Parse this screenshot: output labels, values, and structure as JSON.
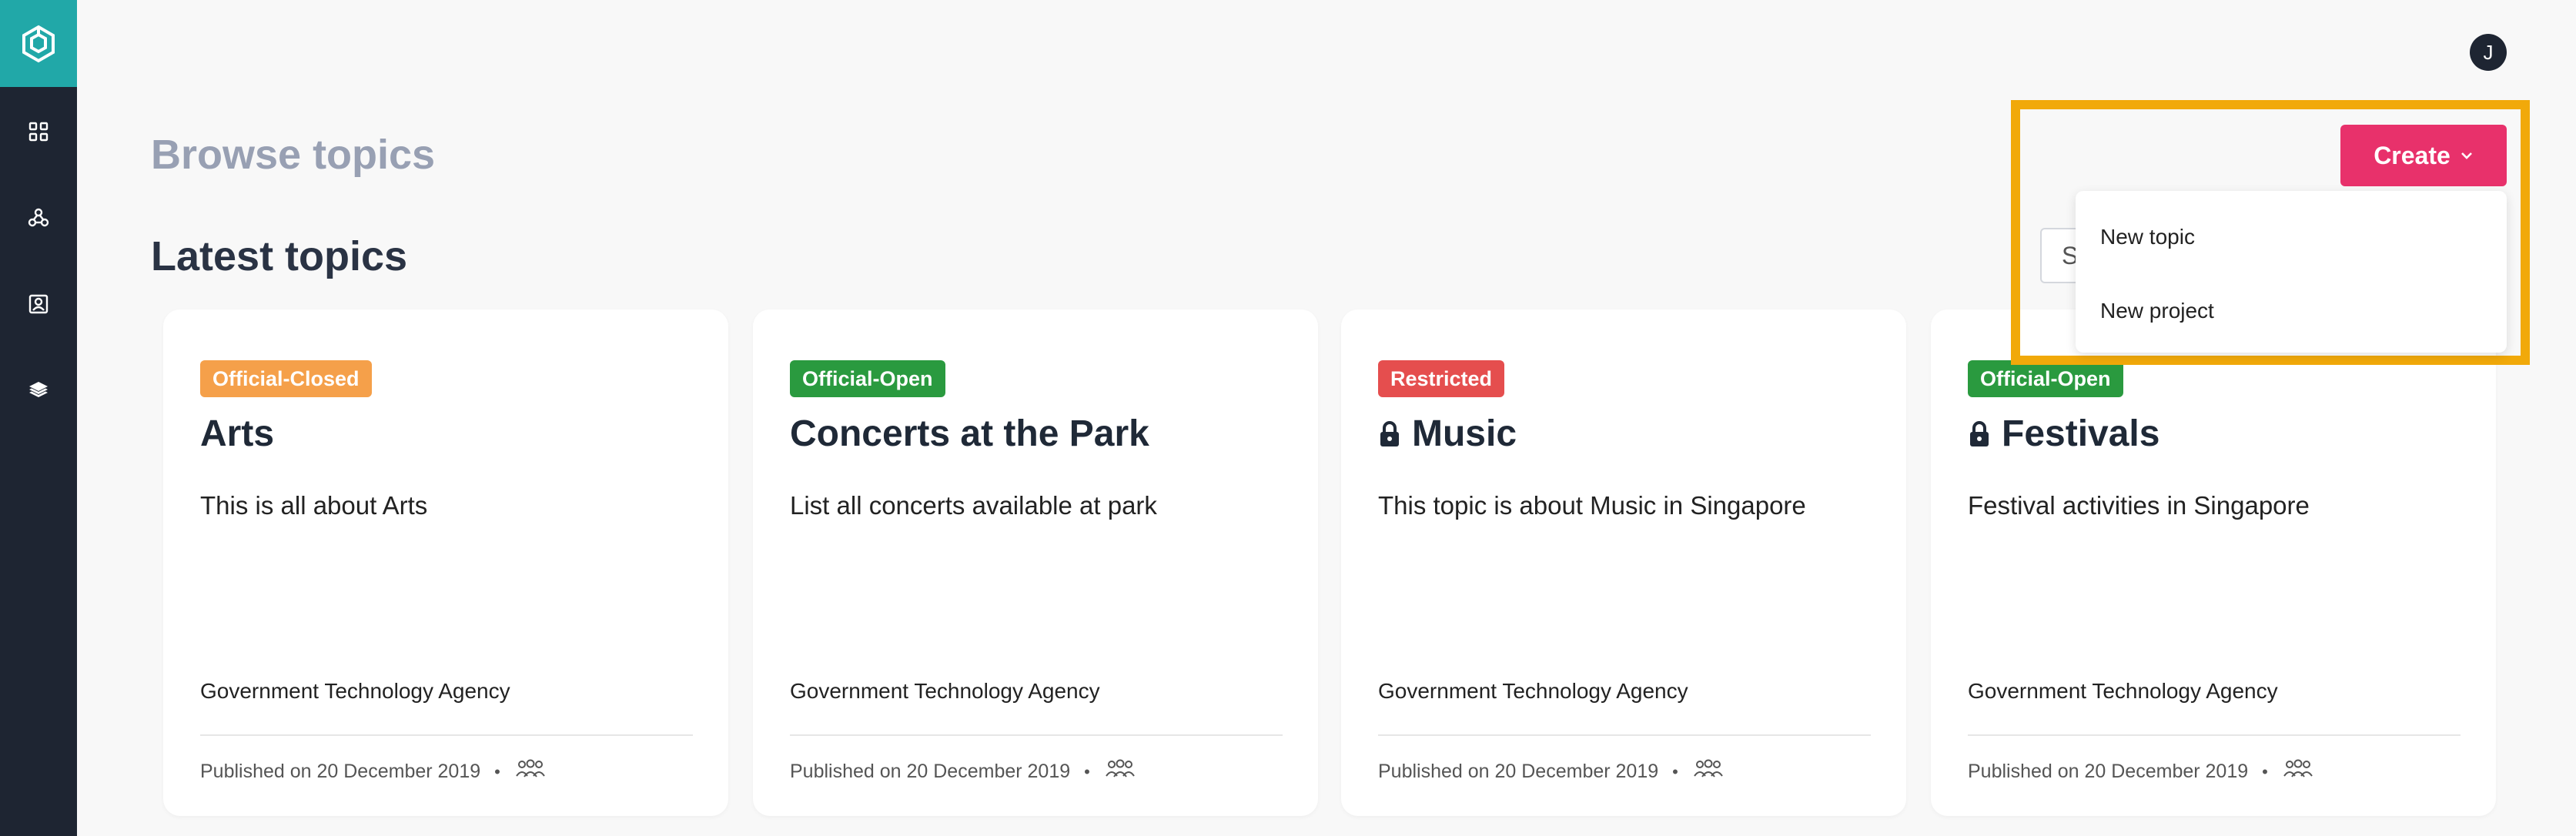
{
  "user": {
    "avatar_initial": "J"
  },
  "page": {
    "browse_title": "Browse topics",
    "latest_title": "Latest topics"
  },
  "search": {
    "visible_text": "S"
  },
  "create": {
    "label": "Create",
    "menu_items": [
      "New topic",
      "New project"
    ]
  },
  "sidebar": {
    "icons": [
      "logo-icon",
      "dashboard-icon",
      "network-icon",
      "contacts-icon",
      "layers-icon"
    ]
  },
  "colors": {
    "sidebar_bg": "#1e2532",
    "logo_bg": "#21a8a8",
    "accent": "#e8316b",
    "highlight": "#f1a90a",
    "badge_official_closed": "#f5a04a",
    "badge_official_open": "#2a9a3f",
    "badge_restricted": "#e54e4e"
  },
  "cards": [
    {
      "badge": "Official-Closed",
      "title": "Arts",
      "locked": false,
      "description": "This is all about Arts",
      "agency": "Government Technology Agency",
      "published": "Published on 20 December 2019"
    },
    {
      "badge": "Official-Open",
      "title": "Concerts at the Park",
      "locked": false,
      "description": "List all concerts available at park",
      "agency": "Government Technology Agency",
      "published": "Published on 20 December 2019"
    },
    {
      "badge": "Restricted",
      "title": "Music",
      "locked": true,
      "description": "This topic is about Music in Singapore",
      "agency": "Government Technology Agency",
      "published": "Published on 20 December 2019"
    },
    {
      "badge": "Official-Open",
      "title": "Festivals",
      "locked": true,
      "description": "Festival activities in Singapore",
      "agency": "Government Technology Agency",
      "published": "Published on 20 December 2019"
    }
  ]
}
